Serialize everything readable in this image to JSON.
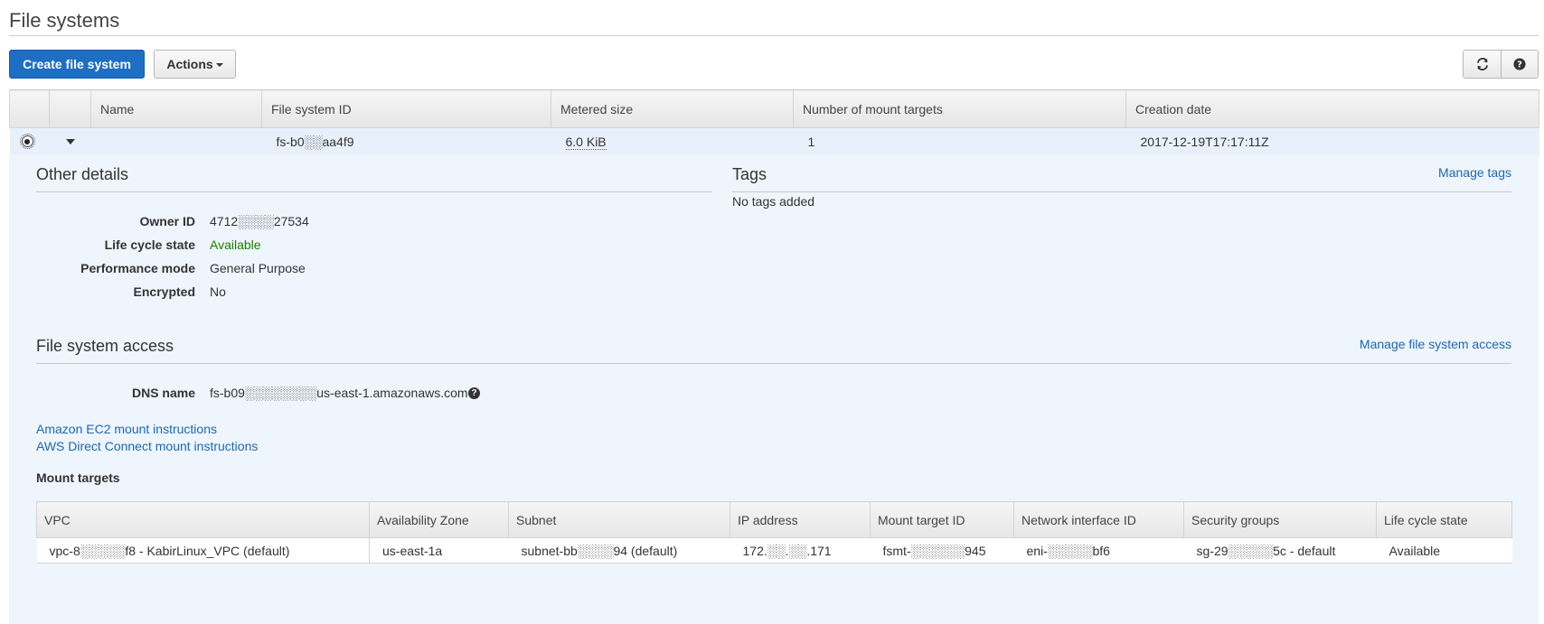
{
  "header": {
    "title": "File systems"
  },
  "toolbar": {
    "create_label": "Create file system",
    "actions_label": "Actions",
    "refresh_icon": "refresh-icon",
    "help_icon": "help-icon"
  },
  "table": {
    "columns": [
      "Name",
      "File system ID",
      "Metered size",
      "Number of mount targets",
      "Creation date"
    ],
    "row": {
      "name": "",
      "file_system_id": "fs-b0░░aa4f9",
      "metered_size": "6.0 KiB",
      "mount_targets": "1",
      "creation_date": "2017-12-19T17:17:11Z"
    }
  },
  "other_details": {
    "title": "Other details",
    "items": [
      {
        "label": "Owner ID",
        "value": "4712░░░░27534"
      },
      {
        "label": "Life cycle state",
        "value": "Available"
      },
      {
        "label": "Performance mode",
        "value": "General Purpose"
      },
      {
        "label": "Encrypted",
        "value": "No"
      }
    ]
  },
  "tags": {
    "title": "Tags",
    "manage_link": "Manage tags",
    "empty_text": "No tags added"
  },
  "access": {
    "title": "File system access",
    "manage_link": "Manage file system access",
    "dns_label": "DNS name",
    "dns_value": "fs-b09░░░░░░░░us-east-1.amazonaws.com",
    "ec2_link": "Amazon EC2 mount instructions",
    "direct_connect_link": "AWS Direct Connect mount instructions"
  },
  "mount_targets": {
    "title": "Mount targets",
    "columns": [
      "VPC",
      "Availability Zone",
      "Subnet",
      "IP address",
      "Mount target ID",
      "Network interface ID",
      "Security groups",
      "Life cycle state"
    ],
    "rows": [
      {
        "vpc": "vpc-8░░░░░f8 - KabirLinux_VPC (default)",
        "az": "us-east-1a",
        "subnet": "subnet-bb░░░░94 (default)",
        "ip": "172.░░.░░.171",
        "mount_target_id": "fsmt-░░░░░░945",
        "eni": "eni-░░░░░bf6",
        "sg": "sg-29░░░░░5c - default",
        "state": "Available"
      }
    ]
  },
  "colors": {
    "primary": "#1e6ec5",
    "link": "#1d67b5",
    "available": "#1d8102",
    "selected_row": "#e8f1fb"
  }
}
